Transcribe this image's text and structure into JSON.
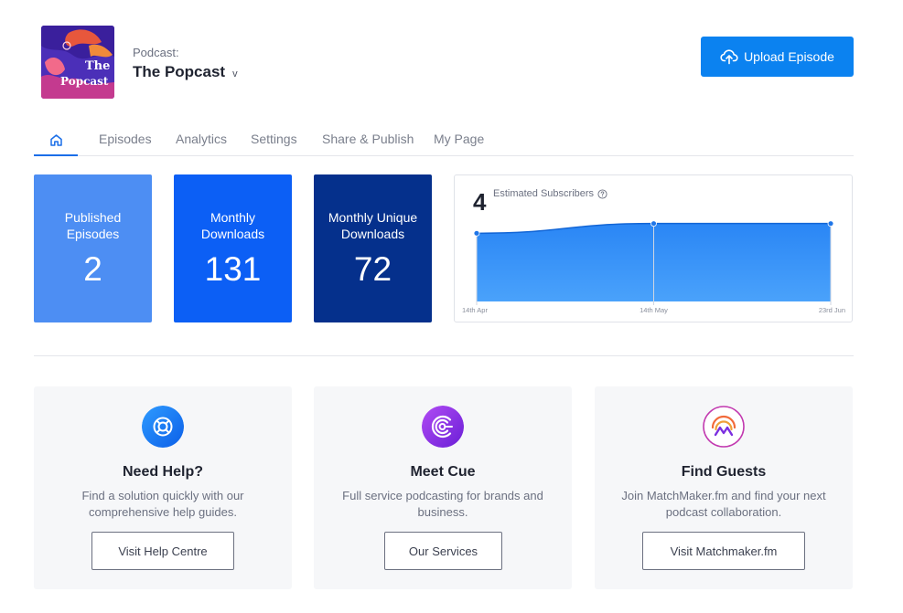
{
  "header": {
    "cover": {
      "line1": "The",
      "line2": "Popcast"
    },
    "kicker": "Podcast:",
    "title": "The Popcast",
    "chevron": "v",
    "upload_label": "Upload Episode"
  },
  "tabs": [
    {
      "label": "home",
      "icon": "home-icon"
    },
    {
      "label": "Episodes"
    },
    {
      "label": "Analytics"
    },
    {
      "label": "Settings"
    },
    {
      "label": "Share & Publish"
    },
    {
      "label": "My Page"
    }
  ],
  "stats": [
    {
      "label": "Published Episodes",
      "value": "2"
    },
    {
      "label": "Monthly Downloads",
      "value": "131"
    },
    {
      "label": "Monthly Unique Downloads",
      "value": "72"
    }
  ],
  "subscribers": {
    "count": "4",
    "label": "Estimated Subscribers",
    "info_icon": "help-circle-icon"
  },
  "chart_data": {
    "type": "area",
    "x": [
      "14th Apr",
      "14th May",
      "23rd Jun"
    ],
    "values": [
      3.5,
      4,
      4
    ],
    "ylim": [
      0,
      4.5
    ],
    "grid": false,
    "color": "#2f8ff5"
  },
  "features": [
    {
      "icon": "lifebuoy-icon",
      "title": "Need Help?",
      "desc": "Find a solution quickly with our comprehensive help guides.",
      "button": "Visit Help Centre"
    },
    {
      "icon": "cue-logo-icon",
      "title": "Meet Cue",
      "desc": "Full service podcasting for brands and business.",
      "button": "Our Services"
    },
    {
      "icon": "matchmaker-logo-icon",
      "title": "Find Guests",
      "desc": "Join MatchMaker.fm and find your next podcast collaboration.",
      "button": "Visit Matchmaker.fm"
    }
  ],
  "colors": {
    "accent": "#0b82f0",
    "stat1": "#4d8ef3",
    "stat2": "#0c5ff5",
    "stat3": "#05308c",
    "cue": "#8a2be2",
    "help": "#1a7cf0"
  }
}
